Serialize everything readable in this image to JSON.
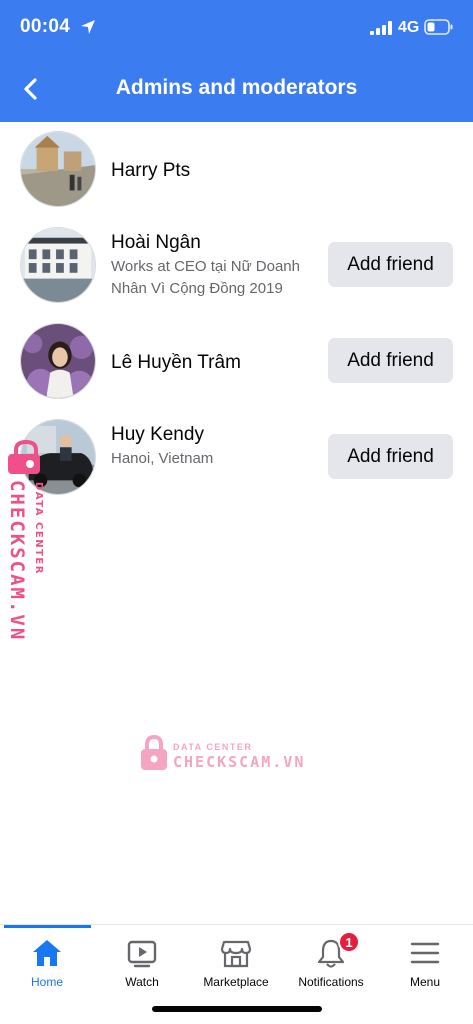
{
  "status_bar": {
    "time": "00:04",
    "network": "4G"
  },
  "header": {
    "title": "Admins and moderators"
  },
  "members": [
    {
      "name": "Harry Pts",
      "subtitle": "",
      "button": ""
    },
    {
      "name": "Hoài Ngân",
      "subtitle": "Works at CEO tại Nữ Doanh Nhân Vì Cộng Đồng 2019",
      "button": "Add friend"
    },
    {
      "name": "Lê Huyền Trâm",
      "subtitle": "",
      "button": "Add friend"
    },
    {
      "name": "Huy Kendy",
      "subtitle": "Hanoi, Vietnam",
      "button": "Add friend"
    }
  ],
  "watermark": {
    "brand": "CHECKSCAM.VN",
    "tag": "DATA CENTER"
  },
  "tabs": [
    {
      "label": "Home",
      "icon": "home-icon",
      "active": true
    },
    {
      "label": "Watch",
      "icon": "watch-icon",
      "active": false
    },
    {
      "label": "Marketplace",
      "icon": "marketplace-icon",
      "active": false
    },
    {
      "label": "Notifications",
      "icon": "bell-icon",
      "active": false,
      "badge": "1"
    },
    {
      "label": "Menu",
      "icon": "menu-icon",
      "active": false
    }
  ],
  "colors": {
    "header": "#3b7cf0",
    "accent": "#1877f2",
    "button_bg": "#e4e6eb",
    "badge": "#e41e3f",
    "watermark": "#f0508a"
  }
}
